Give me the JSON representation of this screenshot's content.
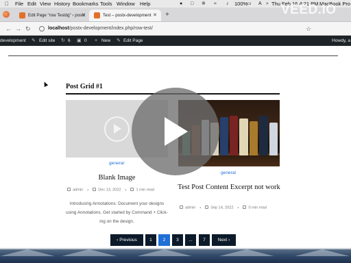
{
  "menubar": {
    "items": [
      "File",
      "Edit",
      "View",
      "History",
      "Bookmarks",
      "Tools",
      "Window",
      "Help"
    ],
    "battery": "100%",
    "clock": "Thu Feb 16  4:21 PM",
    "machine": "MacBook Pro"
  },
  "tabs": [
    {
      "title": "Edit Page \"row Testdg\" ‹ postx",
      "active": false
    },
    {
      "title": "Test – postx-development",
      "active": true
    }
  ],
  "address": {
    "host": "localhost",
    "path": "/postx-development/index.php/row-test/"
  },
  "adminbar": {
    "site": "development",
    "edit_site": "Edit site",
    "updates_count": "6",
    "comments_count": "0",
    "new_label": "New",
    "edit_page": "Edit Page",
    "howdy": "Howdy, a"
  },
  "content": {
    "grid_heading": "Post Grid #1",
    "cards": [
      {
        "category": "general",
        "title": "Blank Image",
        "author": "admin",
        "date": "Dec 13, 2022",
        "read_time": "1 min read",
        "excerpt": "Introducing Annotations: Document your designs using Annotations. Get started by Command + Click-ing on the design."
      },
      {
        "category": "general",
        "title": "Test Post Content Excerpt not work",
        "author": "admin",
        "date": "Sep 14, 2022",
        "read_time": "0 min read"
      }
    ]
  },
  "pagination": {
    "previous": "Previous",
    "pages": [
      "1",
      "2",
      "3",
      "...",
      "7"
    ],
    "current": "2",
    "next": "Next"
  },
  "overlay": {
    "watermark": "VEED.IO"
  },
  "colors": {
    "accent": "#1f6fd6",
    "pagination_bg": "#0c1a2a",
    "adminbar_bg": "#1d2327"
  }
}
